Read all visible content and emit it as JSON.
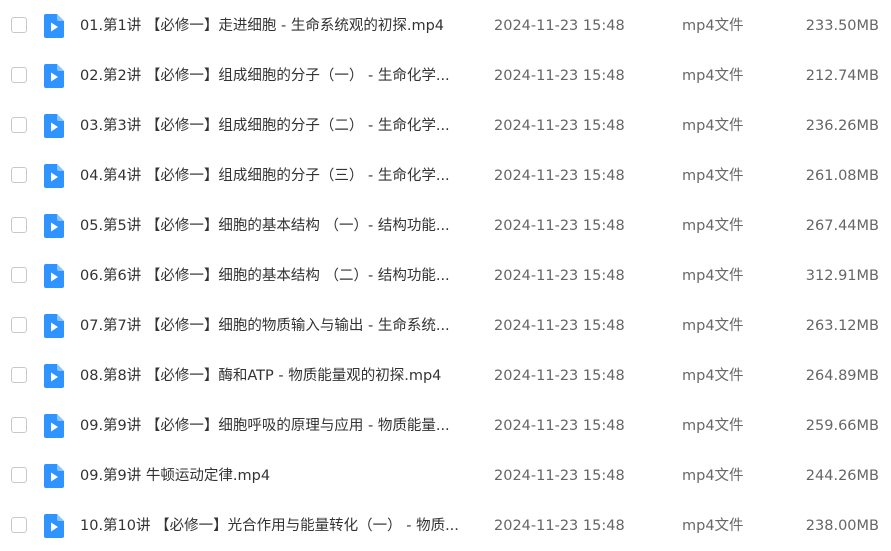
{
  "files": [
    {
      "name": "01.第1讲 【必修一】走进细胞 - 生命系统观的初探.mp4",
      "date": "2024-11-23 15:48",
      "type": "mp4文件",
      "size": "233.50MB"
    },
    {
      "name": "02.第2讲 【必修一】组成细胞的分子（一） - 生命化学...",
      "date": "2024-11-23 15:48",
      "type": "mp4文件",
      "size": "212.74MB"
    },
    {
      "name": "03.第3讲 【必修一】组成细胞的分子（二） - 生命化学...",
      "date": "2024-11-23 15:48",
      "type": "mp4文件",
      "size": "236.26MB"
    },
    {
      "name": "04.第4讲 【必修一】组成细胞的分子（三） - 生命化学...",
      "date": "2024-11-23 15:48",
      "type": "mp4文件",
      "size": "261.08MB"
    },
    {
      "name": "05.第5讲 【必修一】细胞的基本结构 （一）- 结构功能...",
      "date": "2024-11-23 15:48",
      "type": "mp4文件",
      "size": "267.44MB"
    },
    {
      "name": "06.第6讲 【必修一】细胞的基本结构 （二）- 结构功能...",
      "date": "2024-11-23 15:48",
      "type": "mp4文件",
      "size": "312.91MB"
    },
    {
      "name": "07.第7讲 【必修一】细胞的物质输入与输出 - 生命系统...",
      "date": "2024-11-23 15:48",
      "type": "mp4文件",
      "size": "263.12MB"
    },
    {
      "name": "08.第8讲 【必修一】酶和ATP - 物质能量观的初探.mp4",
      "date": "2024-11-23 15:48",
      "type": "mp4文件",
      "size": "264.89MB"
    },
    {
      "name": "09.第9讲 【必修一】细胞呼吸的原理与应用 - 物质能量...",
      "date": "2024-11-23 15:48",
      "type": "mp4文件",
      "size": "259.66MB"
    },
    {
      "name": "09.第9讲 牛顿运动定律.mp4",
      "date": "2024-11-23 15:48",
      "type": "mp4文件",
      "size": "244.26MB"
    },
    {
      "name": "10.第10讲 【必修一】光合作用与能量转化（一） - 物质...",
      "date": "2024-11-23 15:48",
      "type": "mp4文件",
      "size": "238.00MB"
    }
  ],
  "icon": {
    "name": "video-file-icon",
    "color": "#2f94ff"
  }
}
